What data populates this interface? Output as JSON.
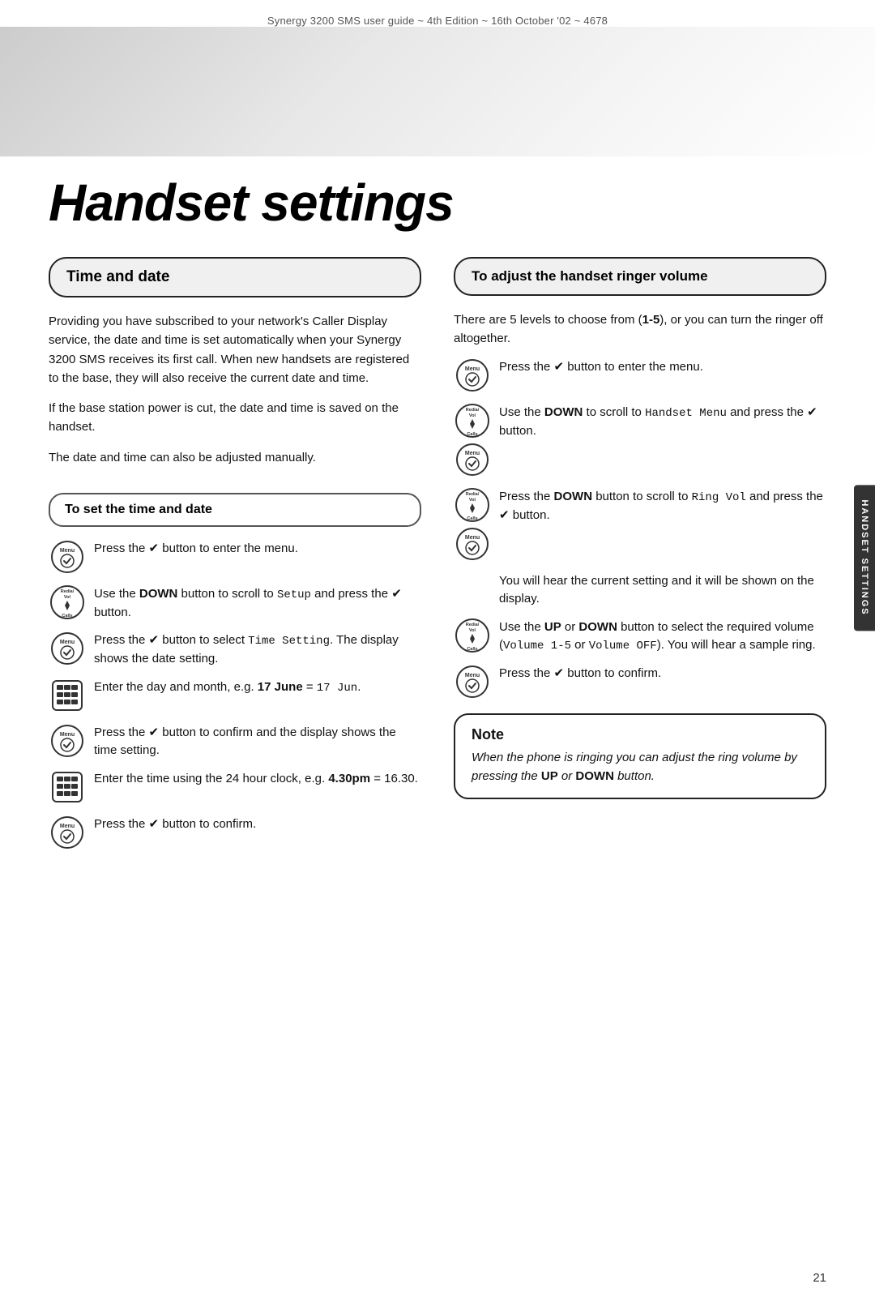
{
  "header": {
    "text": "Synergy 3200 SMS user guide ~ 4th Edition ~ 16th October '02 ~ 4678"
  },
  "title": "Handset settings",
  "left_column": {
    "section_title": "Time and date",
    "body_paragraphs": [
      "Providing you have subscribed to your network's Caller Display service, the date and time is set automatically when your Synergy 3200 SMS receives its first call. When new handsets are registered to the base, they will also receive the current date and time.",
      "If the base station power is cut, the date and time is saved on the handset.",
      "The date and time can also be adjusted manually."
    ],
    "subsection_title": "To set the time and date",
    "instructions": [
      {
        "icon_type": "menu",
        "text": "Press the ✔ button to enter the menu."
      },
      {
        "icon_type": "nav",
        "text_parts": [
          "Use the ",
          "DOWN",
          " button to scroll to ",
          "Setup",
          " and press the ✔ button."
        ]
      },
      {
        "icon_type": "menu",
        "text_parts": [
          "Press the ✔ button to select ",
          "Time Setting",
          ". The display shows the date setting."
        ]
      },
      {
        "icon_type": "keypad",
        "text_parts": [
          "Enter the day and month, e.g. ",
          "17 June",
          " = ",
          "17 Jun",
          "."
        ]
      },
      {
        "icon_type": "menu",
        "text_parts": [
          "Press the ✔ button to confirm and the display shows the time setting."
        ]
      },
      {
        "icon_type": "keypad",
        "text_parts": [
          "Enter the time using the 24 hour clock, e.g. ",
          "4.30pm",
          " = 16.30."
        ]
      },
      {
        "icon_type": "menu",
        "text": "Press the ✔ button to confirm."
      }
    ]
  },
  "right_column": {
    "section_title": "To adjust the handset ringer volume",
    "intro_text": "There are 5 levels to choose from (1-5), or you can turn the ringer off altogether.",
    "instructions": [
      {
        "icon_type": "menu",
        "text": "Press the ✔ button to enter the menu."
      },
      {
        "icon_type": "nav",
        "text_parts": [
          "Use the ",
          "DOWN",
          " to scroll to ",
          "Handset Menu",
          " and press the ✔ button."
        ]
      },
      {
        "icon_type": "nav",
        "text_parts": [
          "Press the ",
          "DOWN",
          " button to scroll to ",
          "Ring Vol",
          " and press the ✔ button."
        ]
      },
      {
        "icon_type": "none",
        "text": "You will hear the current setting and it will be shown on the display."
      },
      {
        "icon_type": "nav",
        "text_parts": [
          "Use the ",
          "UP",
          " or ",
          "DOWN",
          " button to select the required volume (",
          "Volume 1-5",
          " or ",
          "Volume OFF",
          "). You will hear a sample ring."
        ]
      },
      {
        "icon_type": "menu",
        "text": "Press the ✔ button to confirm."
      }
    ],
    "note": {
      "title": "Note",
      "text_parts": [
        "When the phone is ringing you can adjust the ring volume by pressing the ",
        "UP",
        " or ",
        "DOWN",
        " button."
      ]
    }
  },
  "sidebar_tab": "Handset Settings",
  "page_number": "21"
}
